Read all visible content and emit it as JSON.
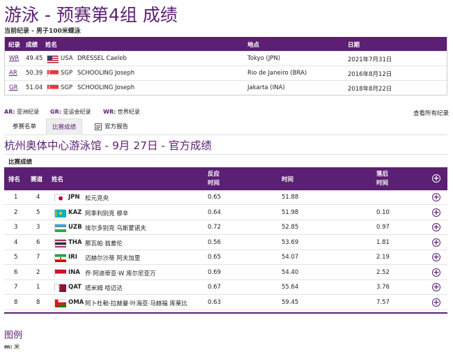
{
  "page_title": "游泳 - 预赛第4组 成绩",
  "records_subtitle": "当前纪录 - 男子100米蝶泳",
  "records": {
    "headers": [
      "纪录",
      "成绩",
      "姓名",
      "地点",
      "日期"
    ],
    "rows": [
      {
        "code": "WR",
        "time": "49.45",
        "noc": "USA",
        "name": "DRESSEL Caeleb",
        "place": "Tokyo (JPN)",
        "date": "2021年7月31日",
        "flag": "usa-flag"
      },
      {
        "code": "AR",
        "time": "50.39",
        "noc": "SGP",
        "name": "SCHOOLING Joseph",
        "place": "Rio de Janeiro (BRA)",
        "date": "2016年8月12日",
        "flag": "sgp-flag"
      },
      {
        "code": "GR",
        "time": "51.04",
        "noc": "SGP",
        "name": "SCHOOLING Joseph",
        "place": "Jakarta (INA)",
        "date": "2018年8月22日",
        "flag": "sgp-flag"
      }
    ]
  },
  "record_legend": [
    {
      "code": "AR:",
      "text": "亚洲纪录"
    },
    {
      "code": "GR:",
      "text": "亚运会纪录"
    },
    {
      "code": "WR:",
      "text": "世界纪录"
    }
  ],
  "view_all": "查看所有纪录",
  "tabs": [
    {
      "label": "参赛名单",
      "active": false
    },
    {
      "label": "比赛成绩",
      "active": true
    },
    {
      "label": "官方报告",
      "active": false
    }
  ],
  "venue_title": "杭州奥体中心游泳馆 - 9月 27日 - 官方成绩",
  "results_label": "比赛成绩",
  "results": {
    "headers": {
      "rank": "排名",
      "lane": "赛道",
      "name": "姓名",
      "reaction": "反应\n时间",
      "time": "时间",
      "behind": "落后\n时间"
    },
    "rows": [
      {
        "rank": "1",
        "lane": "4",
        "noc": "JPN",
        "name": "松元克央",
        "reaction": "0.65",
        "time": "51.88",
        "behind": "",
        "flag": "jpn-flag"
      },
      {
        "rank": "2",
        "lane": "5",
        "noc": "KAZ",
        "name": "阿季利别克 穆辛",
        "reaction": "0.64",
        "time": "51.98",
        "behind": "0.10",
        "flag": "kaz-flag"
      },
      {
        "rank": "3",
        "lane": "3",
        "noc": "UZB",
        "name": "埃尔多别克 乌斯蒙诺夫",
        "reaction": "0.72",
        "time": "52.85",
        "behind": "0.97",
        "flag": "uzb-flag"
      },
      {
        "rank": "4",
        "lane": "6",
        "noc": "THA",
        "name": "那瓦帕 翁差伦",
        "reaction": "0.56",
        "time": "53.69",
        "behind": "1.81",
        "flag": "tha-flag"
      },
      {
        "rank": "5",
        "lane": "7",
        "noc": "IRI",
        "name": "迈赫尔沙蒂 阿夫加里",
        "reaction": "0.65",
        "time": "54.07",
        "behind": "2.19",
        "flag": "iri-flag"
      },
      {
        "rank": "6",
        "lane": "2",
        "noc": "INA",
        "name": "乔·阿迪蒂亚·W 库尔尼亚万",
        "reaction": "0.69",
        "time": "54.40",
        "behind": "2.52",
        "flag": "ina-flag"
      },
      {
        "rank": "7",
        "lane": "1",
        "noc": "QAT",
        "name": "塔米姆 哈迈达",
        "reaction": "0.67",
        "time": "55.64",
        "behind": "3.76",
        "flag": "qat-flag"
      },
      {
        "rank": "8",
        "lane": "8",
        "noc": "OMA",
        "name": "阿卜杜勒·拉赫曼·叶海亚·马赫福 库莱比",
        "reaction": "0.63",
        "time": "59.45",
        "behind": "7.57",
        "flag": "oma-flag"
      }
    ]
  },
  "legend_title": "图例",
  "legend_items": [
    {
      "code": "m:",
      "text": "米"
    }
  ],
  "colors": {
    "brand": "#5b1f73"
  }
}
